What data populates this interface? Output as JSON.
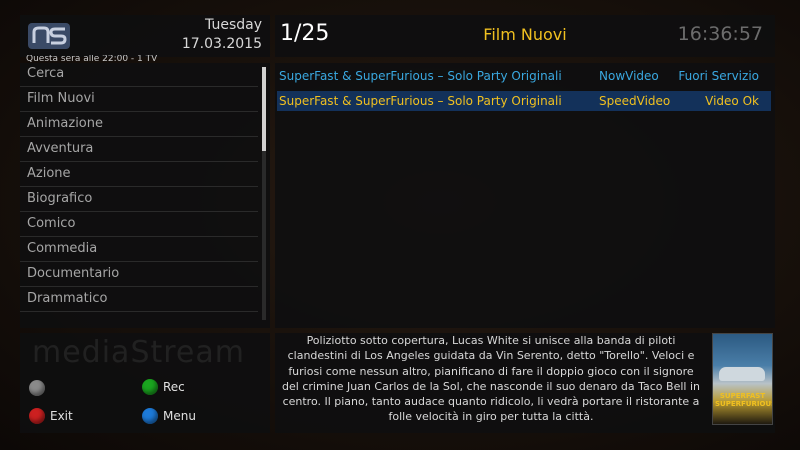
{
  "header": {
    "logo_text": "mS",
    "day": "Tuesday",
    "date": "17.03.2015",
    "counter": "1/25",
    "section_title": "Film Nuovi",
    "clock": "16:36:57"
  },
  "ticker": "Questa sera alle 22:00 - 1 TV",
  "menu": {
    "items": [
      "Cerca",
      "Film Nuovi",
      "Animazione",
      "Avventura",
      "Azione",
      "Biografico",
      "Comico",
      "Commedia",
      "Documentario",
      "Drammatico"
    ],
    "selected_index": 1
  },
  "films": [
    {
      "title": "SuperFast & SuperFurious – Solo Party Originali",
      "host": "NowVideo",
      "status": "Fuori Servizio",
      "selected": false
    },
    {
      "title": "SuperFast & SuperFurious – Solo Party Originali",
      "host": "SpeedVideo",
      "status": "Video Ok",
      "selected": true
    }
  ],
  "watermark": "mediaStream",
  "keys": {
    "grey": "",
    "green": "Rec",
    "red": "Exit",
    "blue": "Menu"
  },
  "synopsis": "Poliziotto sotto copertura, Lucas White si unisce alla banda di piloti clandestini di Los Angeles guidata da Vin Serento, detto \"Torello\". Veloci e furiosi come nessun altro, pianificano di fare il doppio gioco con il signore del crimine Juan Carlos de la Sol, che nasconde il suo denaro da Taco Bell in centro. Il piano, tanto audace quanto ridicolo, li vedrà portare il ristorante a folle velocità in giro per tutta la città.",
  "poster_text": "SUPERFAST SUPERFURIOUS",
  "colors": {
    "accent_yellow": "#f0c020",
    "link_blue": "#3aa8e0",
    "selection_bg": "#13315a",
    "key_green": "#1aa51f",
    "key_red": "#cc2020",
    "key_blue": "#1d7ad8",
    "key_grey": "#8a8a8a"
  }
}
